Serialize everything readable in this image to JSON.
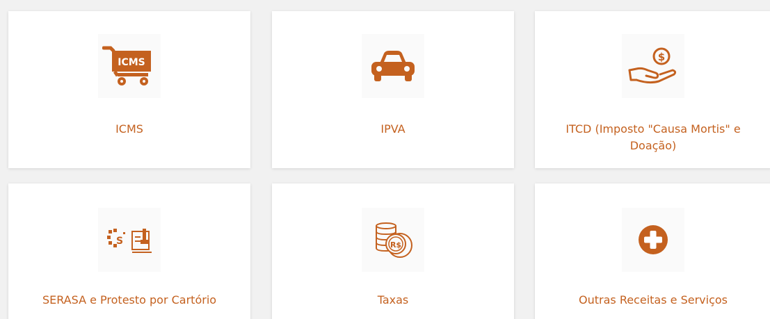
{
  "accent_color": "#c4611f",
  "cards": [
    {
      "label": "ICMS",
      "icon": "shopping-cart-icms-icon",
      "badge": "ICMS"
    },
    {
      "label": "IPVA",
      "icon": "car-icon"
    },
    {
      "label": "ITCD (Imposto \"Causa Mortis\" e Doação)",
      "icon": "hand-coin-icon",
      "coin_symbol": "$"
    },
    {
      "label": "SERASA e Protesto por Cartório",
      "icon": "stamp-document-icon",
      "coin_symbol": "S"
    },
    {
      "label": "Taxas",
      "icon": "coins-stack-icon",
      "coin_symbol": "R$"
    },
    {
      "label": "Outras Receitas e Serviços",
      "icon": "plus-circle-icon"
    }
  ]
}
